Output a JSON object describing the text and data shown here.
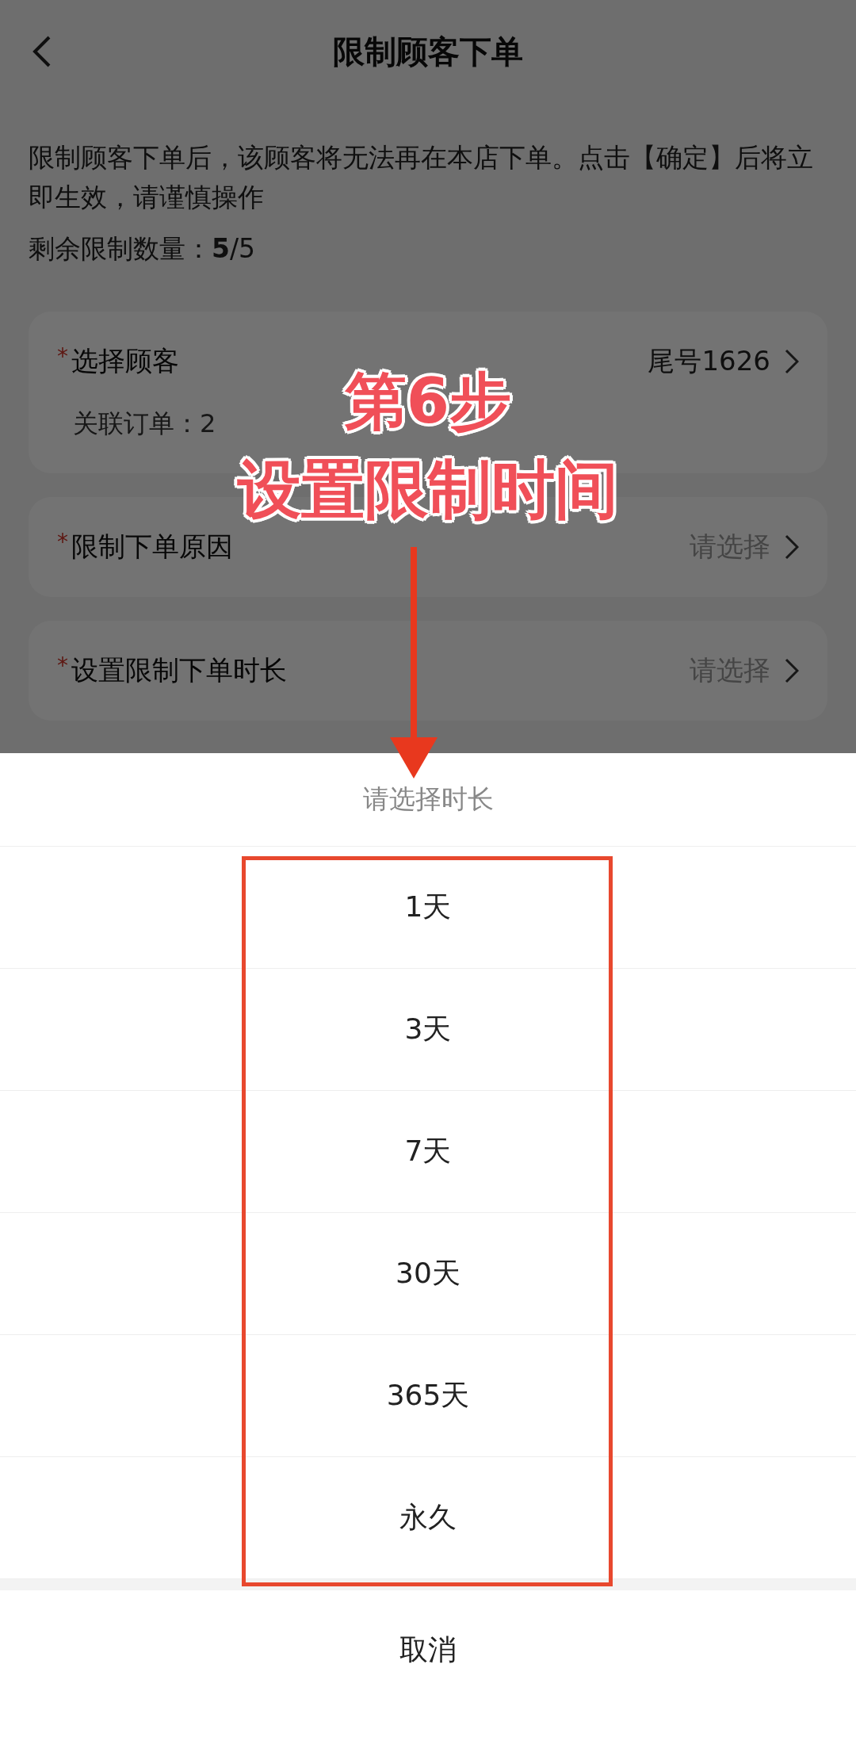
{
  "header": {
    "title": "限制顾客下单"
  },
  "notice": "限制顾客下单后，该顾客将无法再在本店下单。点击【确定】后将立即生效，请谨慎操作",
  "remaining": "剩余限制数量：**5**/5",
  "required_mark": "*",
  "form_cards": [
    {
      "label": "选择顾客",
      "required": true,
      "value": "尾号1626",
      "sub": "关联订单：2"
    },
    {
      "label": "限制下单原因",
      "required": true,
      "placeholder": "请选择"
    },
    {
      "label": "设置限制下单时长",
      "required": true,
      "placeholder": "请选择"
    }
  ],
  "sheet": {
    "title": "请选择时长",
    "options": [
      "1天",
      "3天",
      "7天",
      "30天",
      "365天",
      "永久"
    ],
    "cancel": "取消"
  },
  "annotation": {
    "step": "第6步",
    "caption": "设置限制时间"
  }
}
